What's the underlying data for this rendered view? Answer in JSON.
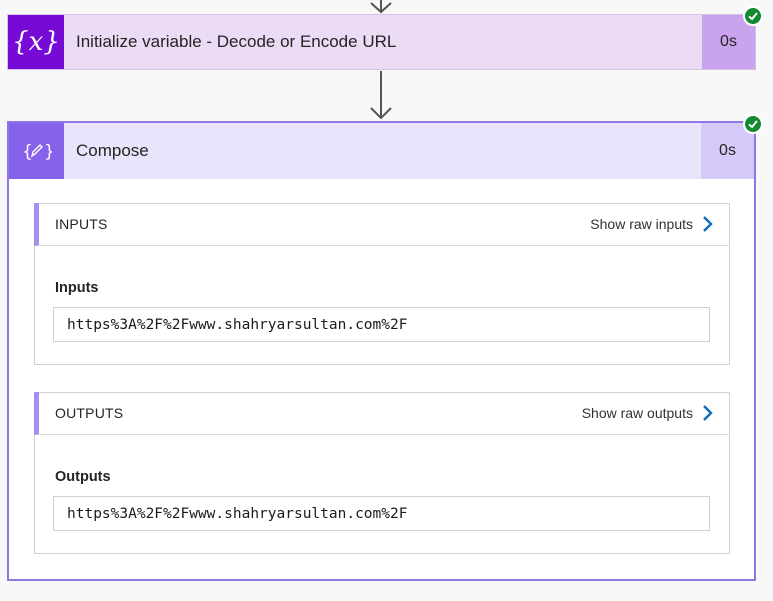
{
  "steps": [
    {
      "title": "Initialize variable - Decode or Encode URL",
      "duration": "0s",
      "icon": "variable-icon",
      "icon_glyph": "{x}",
      "status": "succeeded",
      "accent": "#770bd6"
    },
    {
      "title": "Compose",
      "duration": "0s",
      "icon": "compose-icon",
      "status": "succeeded",
      "accent": "#8662ea",
      "inputs": {
        "section_title": "INPUTS",
        "raw_link": "Show raw inputs",
        "field_label": "Inputs",
        "value": "https%3A%2F%2Fwww.shahryarsultan.com%2F"
      },
      "outputs": {
        "section_title": "OUTPUTS",
        "raw_link": "Show raw outputs",
        "field_label": "Outputs",
        "value": "https%3A%2F%2Fwww.shahryarsultan.com%2F"
      }
    }
  ],
  "colors": {
    "success": "#128a2f",
    "link_chevron": "#0f6cbd"
  }
}
